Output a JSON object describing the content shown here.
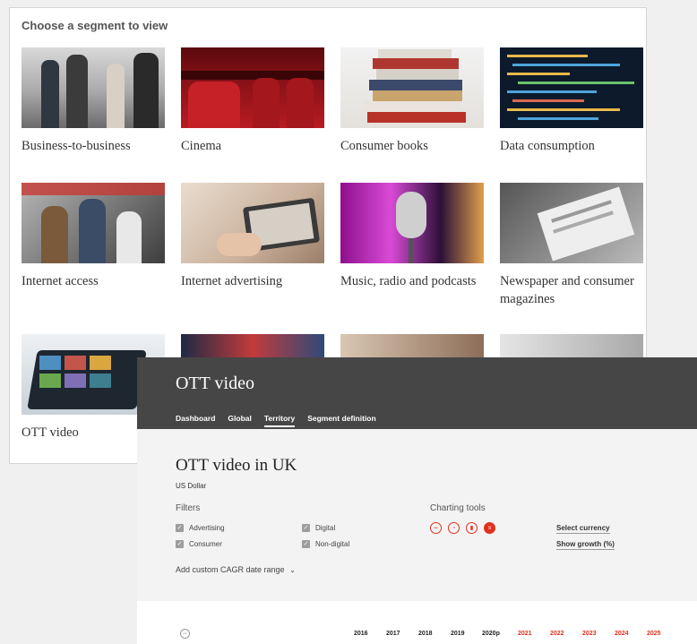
{
  "segments": {
    "title": "Choose a segment to view",
    "items": [
      {
        "label": "Business-to-business"
      },
      {
        "label": "Cinema"
      },
      {
        "label": "Consumer books"
      },
      {
        "label": "Data consumption"
      },
      {
        "label": "Internet access"
      },
      {
        "label": "Internet advertising"
      },
      {
        "label": "Music, radio and podcasts"
      },
      {
        "label": "Newspaper and consumer magazines"
      },
      {
        "label": "OTT video"
      }
    ]
  },
  "ott": {
    "header_title": "OTT video",
    "tabs": [
      {
        "label": "Dashboard"
      },
      {
        "label": "Global"
      },
      {
        "label": "Territory",
        "active": true
      },
      {
        "label": "Segment definition"
      }
    ],
    "territory_title": "OTT video in UK",
    "currency": "US Dollar",
    "filters_title": "Filters",
    "filters": [
      {
        "label": "Advertising",
        "checked": true
      },
      {
        "label": "Digital",
        "checked": true
      },
      {
        "label": "Consumer",
        "checked": true
      },
      {
        "label": "Non-digital",
        "checked": true
      }
    ],
    "cagr_link": "Add custom CAGR date range",
    "charting_title": "Charting tools",
    "chart_tools": [
      {
        "icon": "line-chart-icon",
        "glyph": "∼"
      },
      {
        "icon": "pie-chart-icon",
        "glyph": "◔"
      },
      {
        "icon": "bar-chart-icon",
        "glyph": "▮"
      },
      {
        "icon": "table-icon",
        "glyph": "≡",
        "active": true
      }
    ],
    "select_currency": "Select currency",
    "show_growth": "Show growth (%)",
    "years": [
      "2016",
      "2017",
      "2018",
      "2019",
      "2020p",
      "2021",
      "2022",
      "2023",
      "2024",
      "2025"
    ],
    "forecast_color": "#e0301e",
    "accent_color": "#e0301e"
  }
}
